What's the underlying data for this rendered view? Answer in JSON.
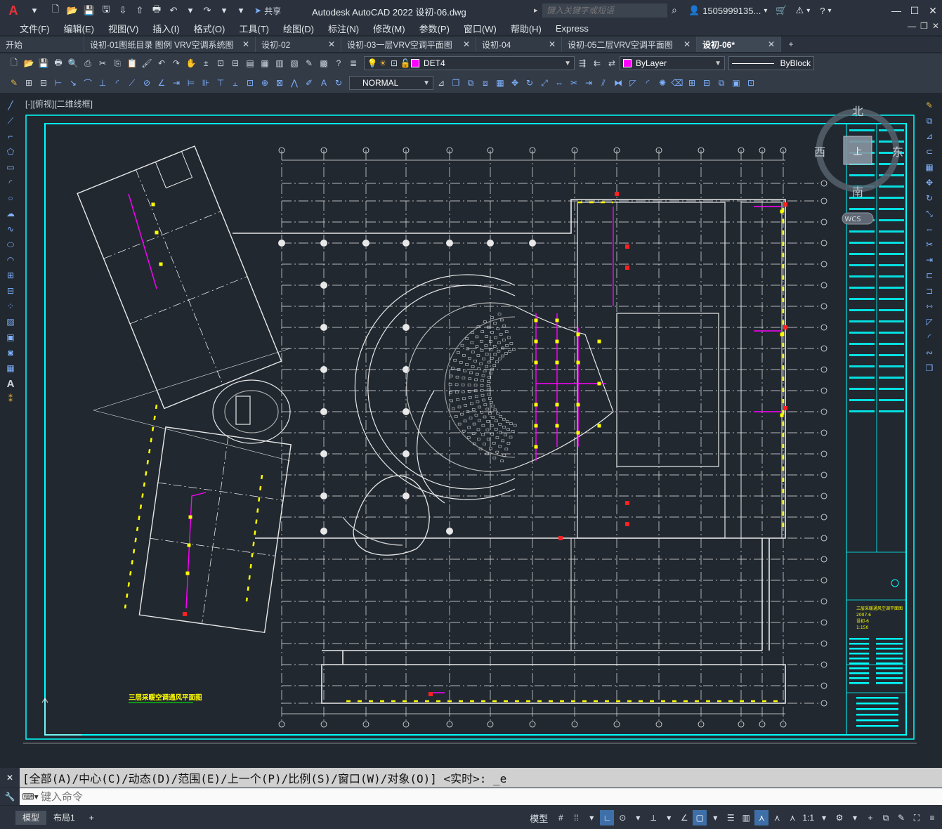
{
  "app": {
    "title": "Autodesk AutoCAD 2022    设初-06.dwg",
    "share_label": "共享",
    "search_placeholder": "键入关键字或短语",
    "user": "1505999135...",
    "logo": "A"
  },
  "menu": [
    "文件(F)",
    "编辑(E)",
    "视图(V)",
    "插入(I)",
    "格式(O)",
    "工具(T)",
    "绘图(D)",
    "标注(N)",
    "修改(M)",
    "参数(P)",
    "窗口(W)",
    "帮助(H)",
    "Express"
  ],
  "tabs": [
    {
      "label": "开始",
      "close": false,
      "active": false,
      "width": 120
    },
    {
      "label": "设初-01图纸目录 图例 VRV空调系统图",
      "close": true,
      "active": false,
      "width": 244
    },
    {
      "label": "设初-02",
      "close": true,
      "active": false,
      "width": 122
    },
    {
      "label": "设初-03一层VRV空调平面图",
      "close": true,
      "active": false,
      "width": 192
    },
    {
      "label": "设初-04",
      "close": true,
      "active": false,
      "width": 122
    },
    {
      "label": "设初-05二层VRV空调平面图",
      "close": true,
      "active": false,
      "width": 192
    },
    {
      "label": "设初-06*",
      "close": true,
      "active": true,
      "width": 120
    }
  ],
  "toolbar": {
    "layer": "DET4",
    "color": "ByLayer",
    "linetype": "ByBlock",
    "style": "NORMAL"
  },
  "viewport": {
    "label": "[-][俯视][二维线框]",
    "compass": {
      "n": "北",
      "s": "南",
      "e": "东",
      "w": "西",
      "top": "上",
      "wcs": "WCS"
    },
    "drawing_title": "三层采暖空调通风平面图",
    "titleblock_lines": [
      "三层采暖通风空调平面图",
      "2007.6",
      "设初-6",
      "1:150"
    ]
  },
  "command": {
    "history": "[全部(A)/中心(C)/动态(D)/范围(E)/上一个(P)/比例(S)/窗口(W)/对象(O)] <实时>: _e",
    "placeholder": "键入命令"
  },
  "status": {
    "layout_tabs": [
      "模型",
      "布局1"
    ],
    "model": "模型",
    "scale": "1:1"
  },
  "colors": {
    "cyan": "#00ffff",
    "magenta": "#ff00ff",
    "yellow": "#ffff00",
    "red": "#ff2020",
    "white": "#e8e8e8"
  }
}
